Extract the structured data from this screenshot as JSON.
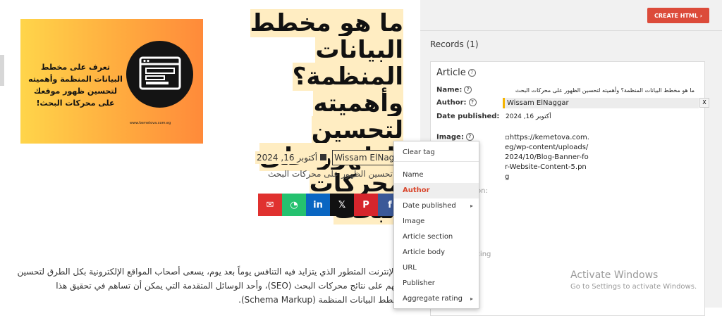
{
  "left_page": {
    "banner": {
      "text": "تعرف على مخطط البيانات المنظمة وأهميته لتحسين ظهور موقعك على محركات البحث!",
      "url": "www.kemetova.com.eg"
    },
    "title": "ما هو مخطط البيانات المنظمة؟ وأهميته لتحسين الظهور على محركات البحث",
    "date": "أكتوبر 16, 2024",
    "author": "Wissam ElNaggar",
    "subtitle": "تحسين الظهور على محركات البحث",
    "share_buttons": [
      {
        "icon": "email-icon",
        "glyph": "✉",
        "color": "#e0312f"
      },
      {
        "icon": "whatsapp-icon",
        "glyph": "◔",
        "color": "#25c16f"
      },
      {
        "icon": "linkedin-icon",
        "glyph": "in",
        "color": "#0a66c2"
      },
      {
        "icon": "x-icon",
        "glyph": "𝕏",
        "color": "#111111"
      },
      {
        "icon": "pinterest-icon",
        "glyph": "P",
        "color": "#d6252c"
      },
      {
        "icon": "facebook-icon",
        "glyph": "f",
        "color": "#3b5998"
      }
    ],
    "body_lines": [
      "عالم الإنترنت المتطور الذي يتزايد فيه التنافس يوماً بعد يوم، يسعى أصحاب المواقع الإلكترونية بكل الطرق لتحسين",
      "مواقعهم على نتائج محركات البحث (SEO)، وأحد الوسائل المتقدمة التي يمكن أن تساهم في تحقيق هذا",
      "هو مخطط البيانات المنظمة (Schema Markup)."
    ]
  },
  "right_panel": {
    "create_button": "CREATE HTML",
    "records_label": "Records (1)",
    "article": {
      "heading": "Article",
      "fields": {
        "name_label": "Name:",
        "name_value": "ما هو مخطط البيانات المنظمة؟ وأهميته لتحسين الظهور على محركات البحث",
        "author_label": "Author:",
        "author_value": "Wissam ElNaggar",
        "date_label": "Date published:",
        "date_value": "أكتوبر 16, 2024",
        "image_label": "Image:",
        "image_value": "https://kemetova.com.eg/wp-content/uploads/2024/10/Blog-Banner-for-Website-Content-5.png",
        "ghost_1": "on:",
        "ghost_2": "ting"
      },
      "remove_label": "X"
    }
  },
  "context_menu": {
    "items": [
      {
        "label": "Clear tag",
        "submenu": false
      },
      {
        "label": "Name",
        "submenu": false
      },
      {
        "label": "Author",
        "submenu": false,
        "active": true
      },
      {
        "label": "Date published",
        "submenu": true
      },
      {
        "label": "Image",
        "submenu": false
      },
      {
        "label": "Article section",
        "submenu": false
      },
      {
        "label": "Article body",
        "submenu": false
      },
      {
        "label": "URL",
        "submenu": false
      },
      {
        "label": "Publisher",
        "submenu": false
      },
      {
        "label": "Aggregate rating",
        "submenu": true
      }
    ]
  },
  "watermark": {
    "title": "Activate Windows",
    "subtitle": "Go to Settings to activate Windows."
  },
  "colors": {
    "highlight": "#ffedc2",
    "accent": "#dc4b3a",
    "menu_active": "#d9452b",
    "author_bar": "#f5b400"
  }
}
